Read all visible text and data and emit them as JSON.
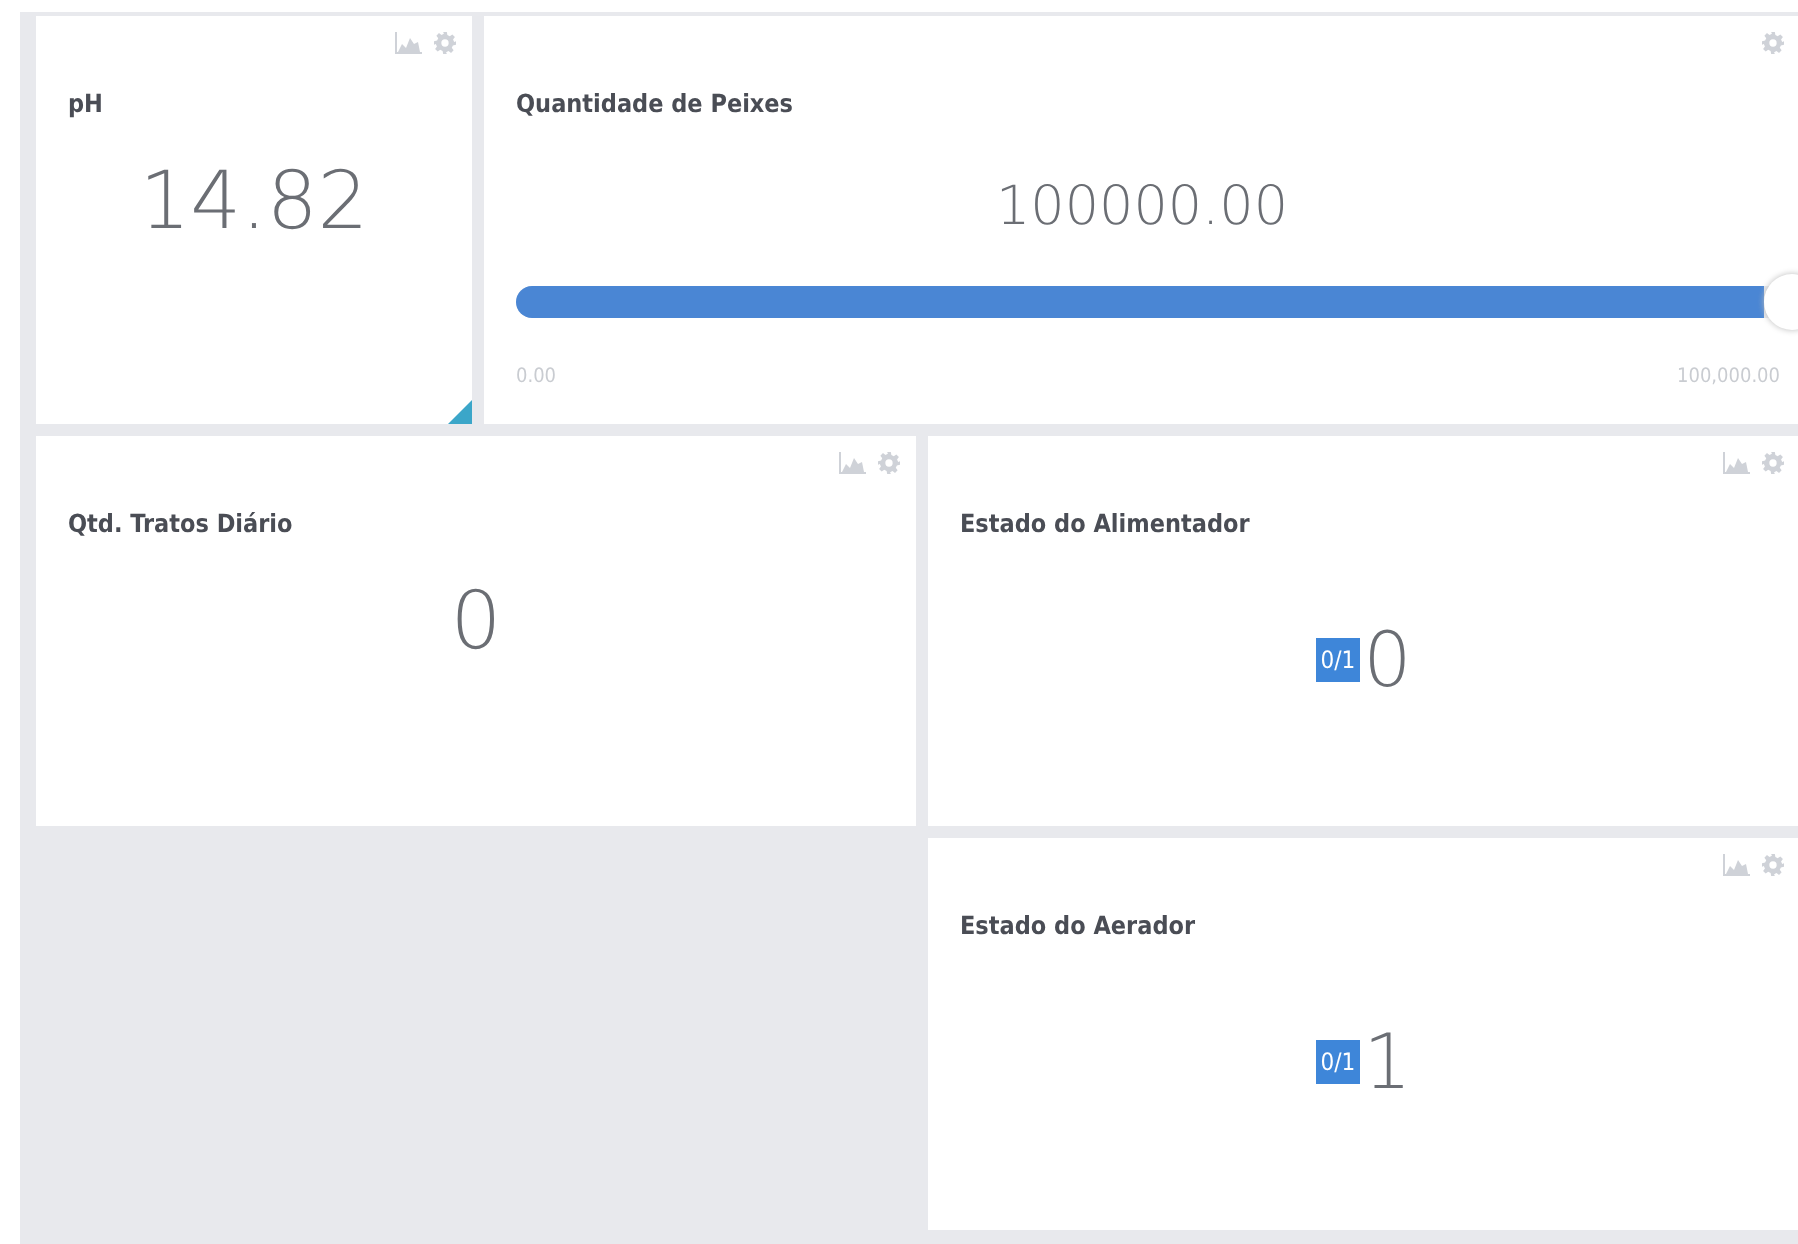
{
  "widgets": [
    {
      "kind": "value",
      "title": "pH",
      "value": "14.82",
      "resizable": true
    },
    {
      "kind": "slider",
      "title": "Quantidade de Peixes",
      "value": "100000.00",
      "level": 1.0,
      "min_label": "0.00",
      "max_label": "100,000.00",
      "resizable": false
    },
    {
      "kind": "value",
      "title": "Qtd. Tratos Diário",
      "value": "0",
      "resizable": false
    },
    {
      "kind": "boolean",
      "title": "Estado do Alimentador",
      "badge": "0/1",
      "value": "0",
      "resizable": false
    },
    {
      "kind": "boolean",
      "title": "Estado do Aerador",
      "badge": "0/1",
      "value": "1",
      "resizable": false
    }
  ]
}
